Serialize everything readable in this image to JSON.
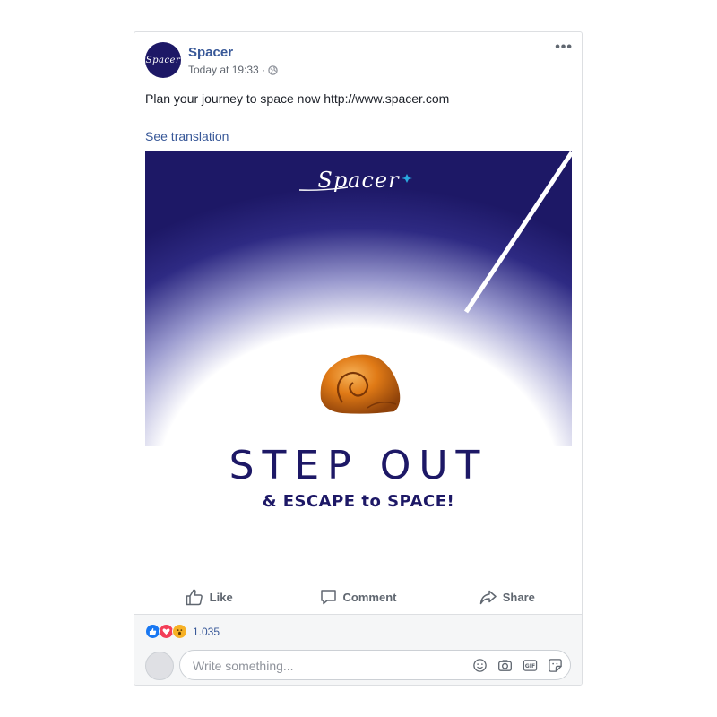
{
  "post": {
    "page_name": "Spacer",
    "timestamp": "Today at 19:33 ·",
    "avatar_logo": "Spacer",
    "text": "Plan your journey to space now http://www.spacer.com",
    "see_translation": "See translation"
  },
  "media": {
    "brand": "Spacer",
    "headline": "STEP OUT",
    "subhead": "& ESCAPE to SPACE!",
    "colors": {
      "navy": "#1d1866",
      "shell": "#e07a16",
      "star": "#29a8e0"
    }
  },
  "actions": [
    {
      "label": "Like",
      "icon": "thumbs-up-icon"
    },
    {
      "label": "Comment",
      "icon": "comment-icon"
    },
    {
      "label": "Share",
      "icon": "share-icon"
    }
  ],
  "reactions": {
    "types": [
      "like",
      "love",
      "wow"
    ],
    "count": "1.035"
  },
  "comment": {
    "placeholder": "Write something...",
    "icons": [
      "emoji-icon",
      "camera-icon",
      "gif-icon",
      "sticker-icon"
    ]
  },
  "theme": {
    "link": "#385898",
    "muted": "#606770",
    "border": "#dddfe2"
  }
}
